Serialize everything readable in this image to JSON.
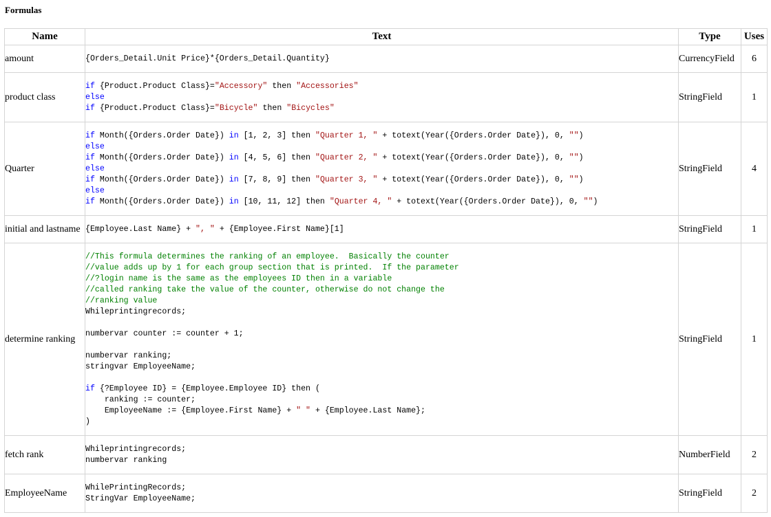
{
  "section_title": "Formulas",
  "columns": {
    "name": "Name",
    "text": "Text",
    "type": "Type",
    "uses": "Uses"
  },
  "rows": [
    {
      "name": "amount",
      "type": "CurrencyField",
      "uses": "6",
      "lines": [
        [
          {
            "t": "{Orders_Detail.Unit Price}*{Orders_Detail.Quantity}",
            "c": "plain"
          }
        ]
      ]
    },
    {
      "name": "product class",
      "type": "StringField",
      "uses": "1",
      "lines": [
        [
          {
            "t": "if",
            "c": "kw"
          },
          {
            "t": " {Product.Product Class}=",
            "c": "plain"
          },
          {
            "t": "\"Accessory\"",
            "c": "str"
          },
          {
            "t": " then ",
            "c": "plain"
          },
          {
            "t": "\"Accessories\"",
            "c": "str"
          }
        ],
        [
          {
            "t": "else",
            "c": "kw"
          }
        ],
        [
          {
            "t": "if",
            "c": "kw"
          },
          {
            "t": " {Product.Product Class}=",
            "c": "plain"
          },
          {
            "t": "\"Bicycle\"",
            "c": "str"
          },
          {
            "t": " then ",
            "c": "plain"
          },
          {
            "t": "\"Bicycles\"",
            "c": "str"
          }
        ]
      ]
    },
    {
      "name": "Quarter",
      "type": "StringField",
      "uses": "4",
      "lines": [
        [
          {
            "t": "if",
            "c": "kw"
          },
          {
            "t": " Month({Orders.Order Date}) ",
            "c": "plain"
          },
          {
            "t": "in",
            "c": "kw"
          },
          {
            "t": " [1, 2, 3] then ",
            "c": "plain"
          },
          {
            "t": "\"Quarter 1, \"",
            "c": "str"
          },
          {
            "t": " + totext(Year({Orders.Order Date}), 0, ",
            "c": "plain"
          },
          {
            "t": "\"\"",
            "c": "str"
          },
          {
            "t": ")",
            "c": "plain"
          }
        ],
        [
          {
            "t": "else",
            "c": "kw"
          }
        ],
        [
          {
            "t": "if",
            "c": "kw"
          },
          {
            "t": " Month({Orders.Order Date}) ",
            "c": "plain"
          },
          {
            "t": "in",
            "c": "kw"
          },
          {
            "t": " [4, 5, 6] then ",
            "c": "plain"
          },
          {
            "t": "\"Quarter 2, \"",
            "c": "str"
          },
          {
            "t": " + totext(Year({Orders.Order Date}), 0, ",
            "c": "plain"
          },
          {
            "t": "\"\"",
            "c": "str"
          },
          {
            "t": ")",
            "c": "plain"
          }
        ],
        [
          {
            "t": "else",
            "c": "kw"
          }
        ],
        [
          {
            "t": "if",
            "c": "kw"
          },
          {
            "t": " Month({Orders.Order Date}) ",
            "c": "plain"
          },
          {
            "t": "in",
            "c": "kw"
          },
          {
            "t": " [7, 8, 9] then ",
            "c": "plain"
          },
          {
            "t": "\"Quarter 3, \"",
            "c": "str"
          },
          {
            "t": " + totext(Year({Orders.Order Date}), 0, ",
            "c": "plain"
          },
          {
            "t": "\"\"",
            "c": "str"
          },
          {
            "t": ")",
            "c": "plain"
          }
        ],
        [
          {
            "t": "else",
            "c": "kw"
          }
        ],
        [
          {
            "t": "if",
            "c": "kw"
          },
          {
            "t": " Month({Orders.Order Date}) ",
            "c": "plain"
          },
          {
            "t": "in",
            "c": "kw"
          },
          {
            "t": " [10, 11, 12] then ",
            "c": "plain"
          },
          {
            "t": "\"Quarter 4, \"",
            "c": "str"
          },
          {
            "t": " + totext(Year({Orders.Order Date}), 0, ",
            "c": "plain"
          },
          {
            "t": "\"\"",
            "c": "str"
          },
          {
            "t": ")",
            "c": "plain"
          }
        ]
      ]
    },
    {
      "name": "initial and lastname",
      "type": "StringField",
      "uses": "1",
      "lines": [
        [
          {
            "t": "{Employee.Last Name} + ",
            "c": "plain"
          },
          {
            "t": "\", \"",
            "c": "str"
          },
          {
            "t": " + {Employee.First Name}[1]",
            "c": "plain"
          }
        ]
      ]
    },
    {
      "name": "determine ranking",
      "type": "StringField",
      "uses": "1",
      "lines": [
        [
          {
            "t": "//This formula determines the ranking of an employee.  Basically the counter",
            "c": "cm"
          }
        ],
        [
          {
            "t": "//value adds up by 1 for each group section that is printed.  If the parameter",
            "c": "cm"
          }
        ],
        [
          {
            "t": "//?login name is the same as the employees ID then in a variable",
            "c": "cm"
          }
        ],
        [
          {
            "t": "//called ranking take the value of the counter, otherwise do not change the",
            "c": "cm"
          }
        ],
        [
          {
            "t": "//ranking value",
            "c": "cm"
          }
        ],
        [
          {
            "t": "Whileprintingrecords;",
            "c": "plain"
          }
        ],
        [],
        [
          {
            "t": "numbervar counter := counter + 1;",
            "c": "plain"
          }
        ],
        [],
        [
          {
            "t": "numbervar ranking;",
            "c": "plain"
          }
        ],
        [
          {
            "t": "stringvar EmployeeName;",
            "c": "plain"
          }
        ],
        [],
        [
          {
            "t": "if",
            "c": "kw"
          },
          {
            "t": " {?Employee ID} = {Employee.Employee ID} then (",
            "c": "plain"
          }
        ],
        [
          {
            "t": "    ranking := counter;",
            "c": "plain"
          }
        ],
        [
          {
            "t": "    EmployeeName := {Employee.First Name} + ",
            "c": "plain"
          },
          {
            "t": "\" \"",
            "c": "str"
          },
          {
            "t": " + {Employee.Last Name};",
            "c": "plain"
          }
        ],
        [
          {
            "t": ")",
            "c": "plain"
          }
        ]
      ]
    },
    {
      "name": "fetch rank",
      "type": "NumberField",
      "uses": "2",
      "lines": [
        [
          {
            "t": "Whileprintingrecords;",
            "c": "plain"
          }
        ],
        [
          {
            "t": "numbervar ranking",
            "c": "plain"
          }
        ]
      ]
    },
    {
      "name": "EmployeeName",
      "type": "StringField",
      "uses": "2",
      "lines": [
        [
          {
            "t": "WhilePrintingRecords;",
            "c": "plain"
          }
        ],
        [
          {
            "t": "StringVar EmployeeName;",
            "c": "plain"
          }
        ]
      ]
    }
  ]
}
